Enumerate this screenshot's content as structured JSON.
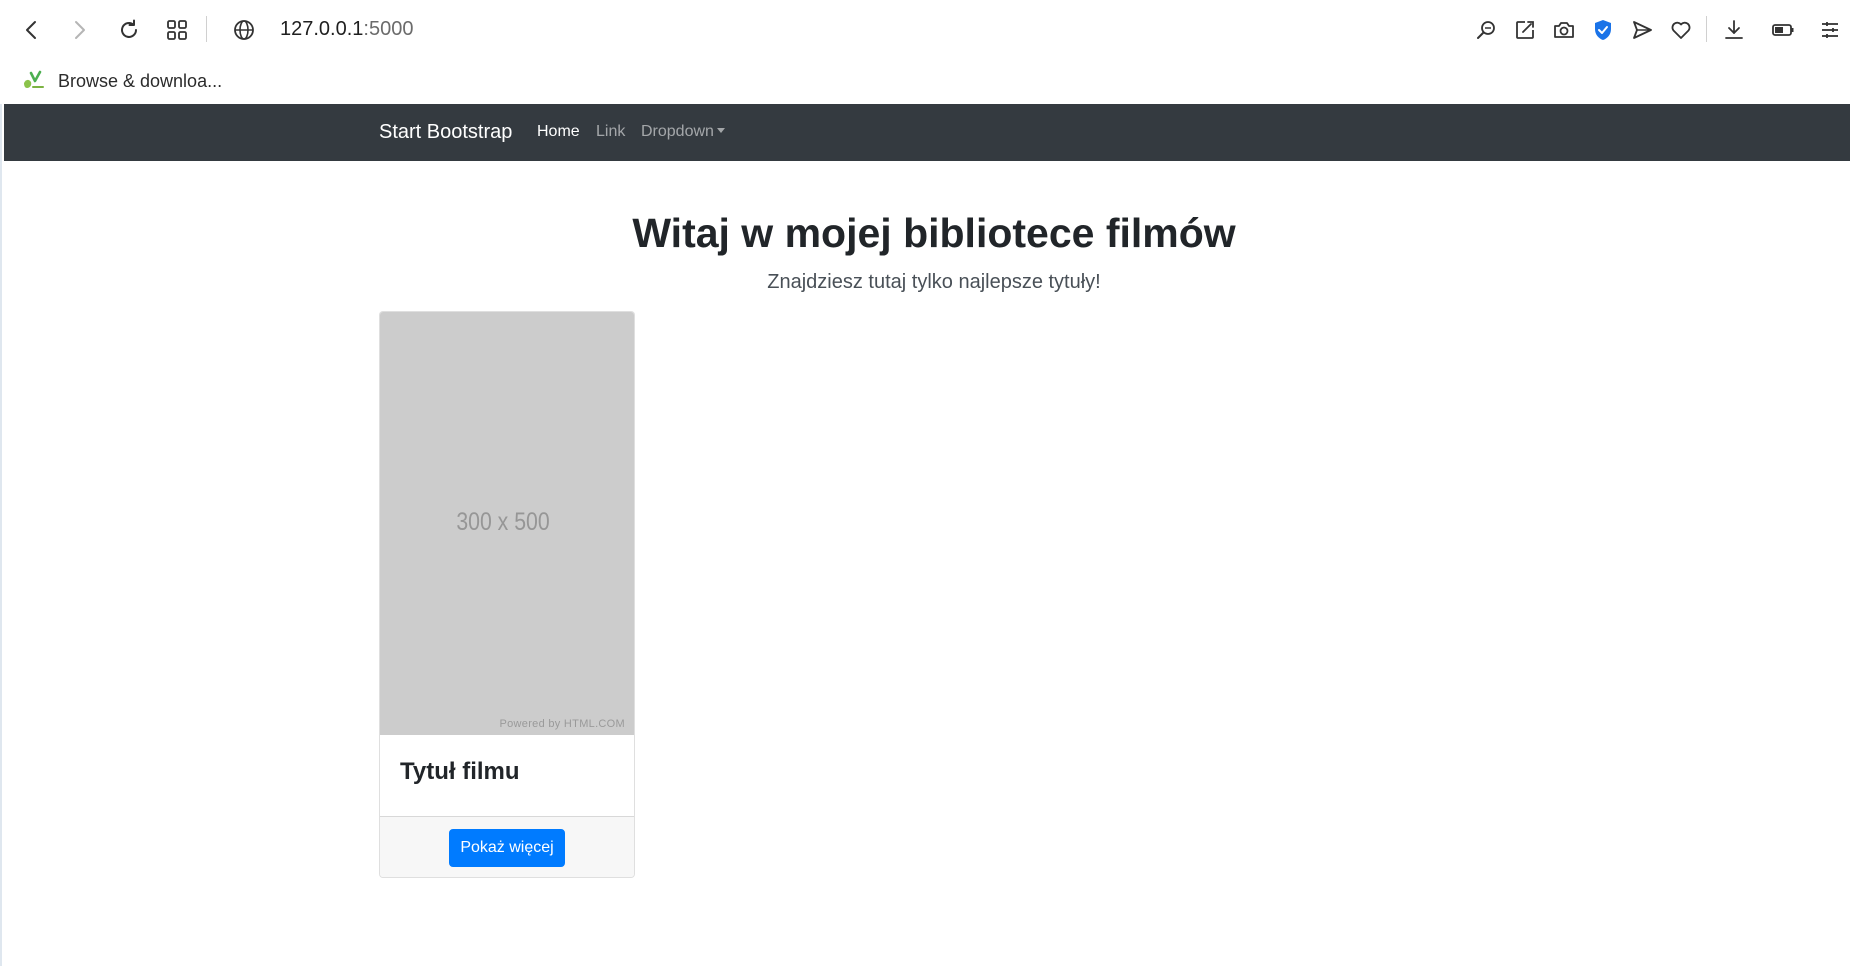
{
  "browser": {
    "address_host": "127.0.0.1",
    "address_port": ":5000",
    "bookmark_label": "Browse & downloa..."
  },
  "navbar": {
    "brand": "Start Bootstrap",
    "links": [
      {
        "label": "Home",
        "active": true
      },
      {
        "label": "Link",
        "active": false
      },
      {
        "label": "Dropdown",
        "active": false
      }
    ]
  },
  "hero": {
    "title": "Witaj w mojej bibliotece filmów",
    "subtitle": "Znajdziesz tutaj tylko najlepsze tytuły!"
  },
  "movies": [
    {
      "placeholder_text": "300 x 500",
      "placeholder_credit": "Powered by HTML.COM",
      "title": "Tytuł filmu",
      "button_label": "Pokaż więcej"
    }
  ],
  "colors": {
    "navbar_bg": "#343a40",
    "primary": "#007bff",
    "placeholder_bg": "#cccccc",
    "shield_blue": "#1a73e8"
  },
  "icons": [
    "back-icon",
    "forward-icon",
    "reload-icon",
    "tab-grid-icon",
    "site-info-icon",
    "zoom-icon",
    "edit-icon",
    "camera-icon",
    "shield-icon",
    "send-icon",
    "heart-icon",
    "download-icon",
    "battery-icon",
    "menu-icon",
    "bookmark-favicon"
  ]
}
